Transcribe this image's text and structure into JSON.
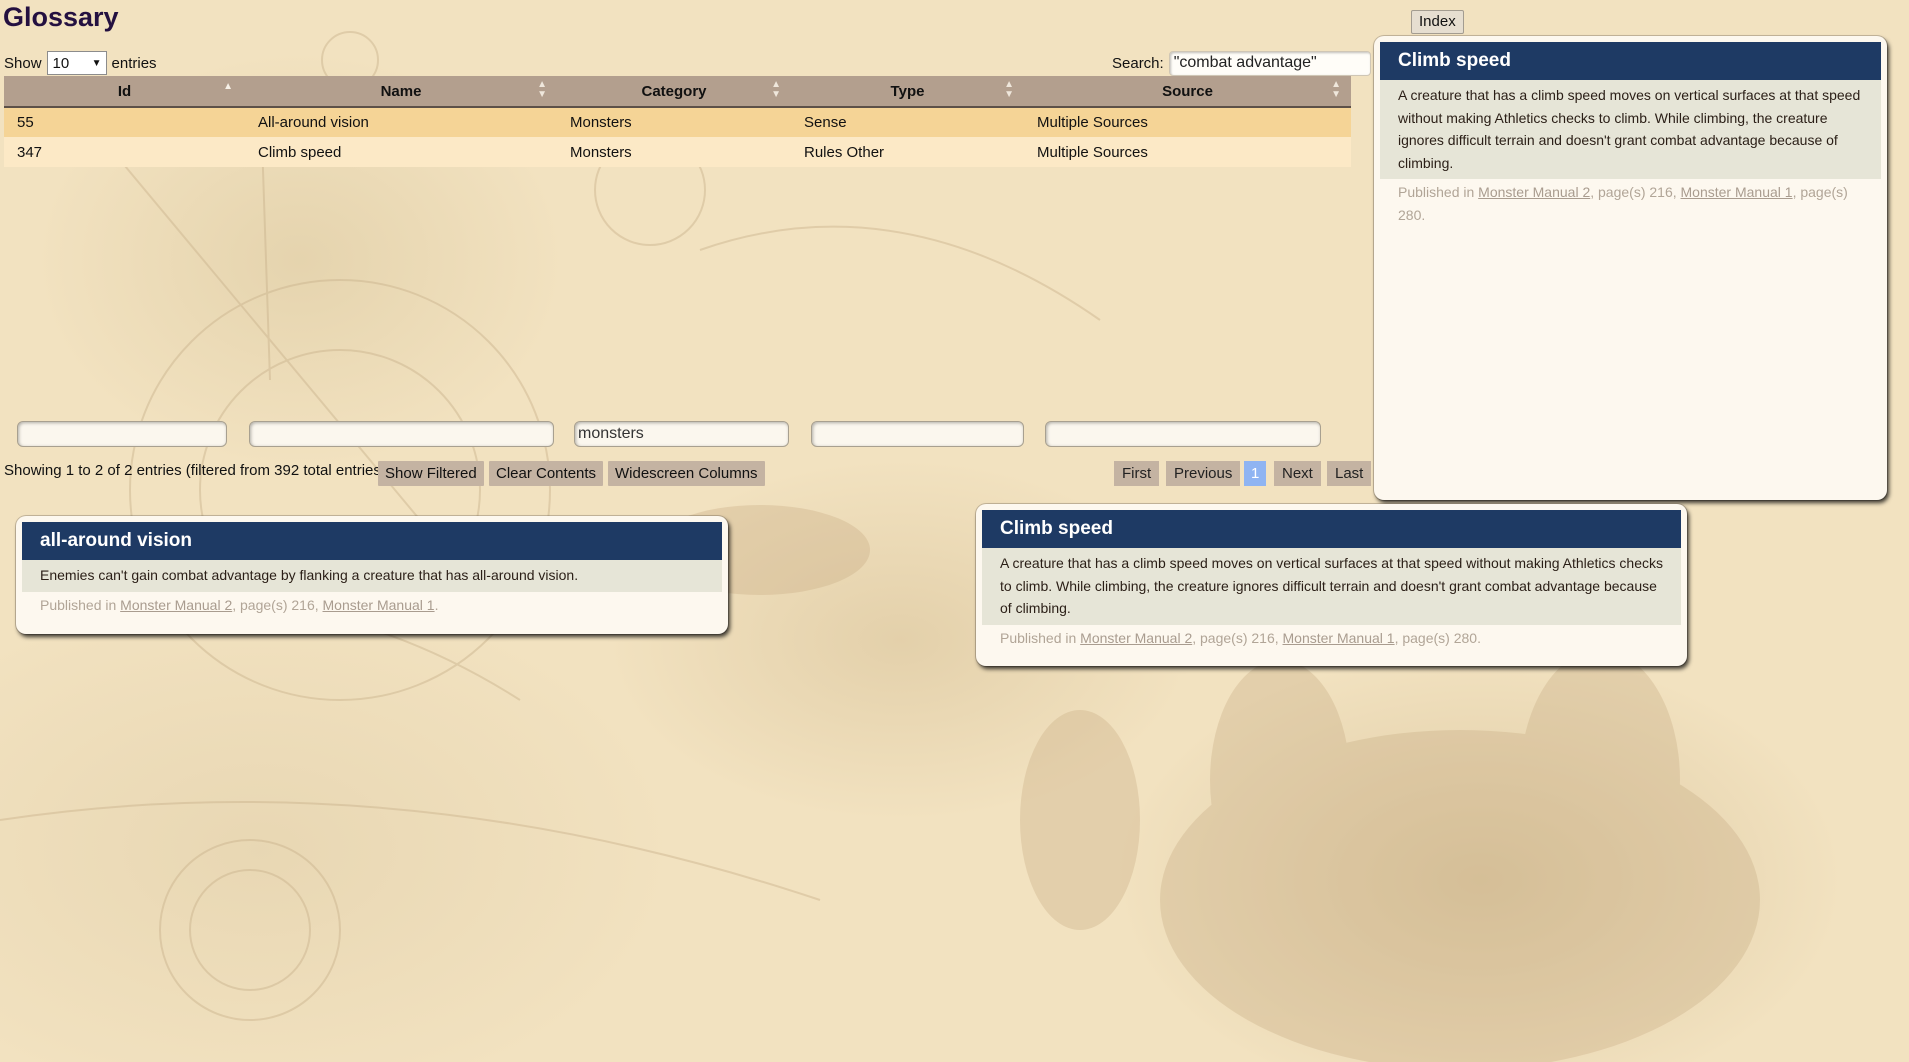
{
  "page": {
    "title": "Glossary",
    "index_button": "Index"
  },
  "length_menu": {
    "show_label": "Show",
    "value": "10",
    "entries_label": "entries"
  },
  "search": {
    "label": "Search:",
    "value": "\"combat advantage\""
  },
  "table": {
    "columns": [
      "Id",
      "Name",
      "Category",
      "Type",
      "Source"
    ],
    "rows": [
      [
        "55",
        "All-around vision",
        "Monsters",
        "Sense",
        "Multiple Sources"
      ],
      [
        "347",
        "Climb speed",
        "Monsters",
        "Rules Other",
        "Multiple Sources"
      ]
    ]
  },
  "column_filters": [
    "",
    "",
    "monsters",
    "",
    ""
  ],
  "info": "Showing 1 to 2 of 2 entries (filtered from 392 total entries)",
  "tools": {
    "show_filtered": "Show Filtered",
    "clear_contents": "Clear Contents",
    "widescreen_columns": "Widescreen Columns"
  },
  "pagination": {
    "first": "First",
    "previous": "Previous",
    "current": "1",
    "next": "Next",
    "last": "Last"
  },
  "popups": {
    "top_right": {
      "title": "Climb speed",
      "body": "A creature that has a climb speed moves on vertical surfaces at that speed without making Athletics checks to climb. While climbing, the creature ignores difficult terrain and doesn't grant combat advantage because of climbing.",
      "published_in": "Published in",
      "source1": "Monster Manual 2",
      "mid": ", page(s) 216,",
      "source2": "Monster Manual 1",
      "tail": ", page(s) 280."
    },
    "all_around": {
      "title": "all-around vision",
      "body": "Enemies can't gain combat advantage by flanking a creature that has all-around vision.",
      "published_in": "Published in",
      "source1": "Monster Manual 2",
      "mid": ", page(s) 216,",
      "source2": "Monster Manual 1",
      "tail": "."
    },
    "climb": {
      "title": "Climb speed",
      "body": "A creature that has a climb speed moves on vertical surfaces at that speed without making Athletics checks to climb. While climbing, the creature ignores difficult terrain and doesn't grant combat advantage because of climbing.",
      "published_in": "Published in",
      "source1": "Monster Manual 2",
      "mid": ", page(s) 216,",
      "source2": "Monster Manual 1",
      "tail": ", page(s) 280."
    }
  },
  "colors": {
    "title_bar": "#1e3a64",
    "header_bg": "#b39f8e",
    "row_odd": "#f5d496",
    "row_even": "#fce9c6",
    "button_bg": "#c4b3a2",
    "page_current": "#8fb4f2",
    "page_bg": "#f2e2c0"
  },
  "icons": {
    "sort": "sort-arrows-icon",
    "dropdown": "chevron-down-icon"
  }
}
